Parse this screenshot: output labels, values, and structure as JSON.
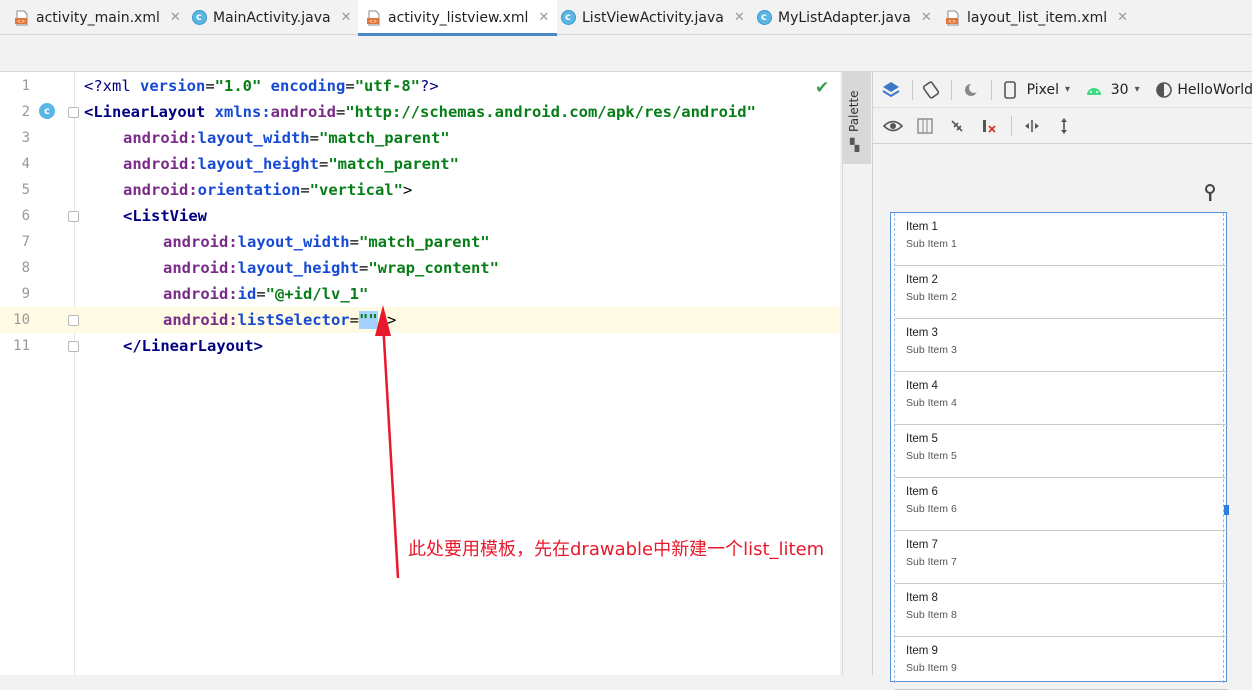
{
  "tabs": [
    {
      "label": "activity_main.xml",
      "icon": "xml-layout-icon",
      "active": false
    },
    {
      "label": "MainActivity.java",
      "icon": "class-c-icon",
      "active": false
    },
    {
      "label": "activity_listview.xml",
      "icon": "xml-layout-icon",
      "active": true
    },
    {
      "label": "ListViewActivity.java",
      "icon": "class-c-icon",
      "active": false
    },
    {
      "label": "MyListAdapter.java",
      "icon": "class-c-icon",
      "active": false
    },
    {
      "label": "layout_list_item.xml",
      "icon": "xml-layout-icon",
      "active": false
    }
  ],
  "close_glyph": "✕",
  "editor": {
    "current_line": 10,
    "lines": [
      {
        "n": "1"
      },
      {
        "n": "2"
      },
      {
        "n": "3"
      },
      {
        "n": "4"
      },
      {
        "n": "5"
      },
      {
        "n": "6"
      },
      {
        "n": "7"
      },
      {
        "n": "8"
      },
      {
        "n": "9"
      },
      {
        "n": "10"
      },
      {
        "n": "11"
      }
    ],
    "tokens": {
      "l1_a": "<?xml ",
      "l1_b": "version",
      "l1_c": "=",
      "l1_d": "\"1.0\"",
      "l1_e": " encoding",
      "l1_f": "=",
      "l1_g": "\"utf-8\"",
      "l1_h": "?>",
      "l2_a": "<LinearLayout ",
      "l2_b": "xmlns:",
      "l2_c": "android",
      "l2_d": "=",
      "l2_e": "\"http://schemas.android.com/apk/res/android\"",
      "l3_a": "android:",
      "l3_b": "layout_width",
      "l3_c": "=",
      "l3_d": "\"match_parent\"",
      "l4_a": "android:",
      "l4_b": "layout_height",
      "l4_c": "=",
      "l4_d": "\"match_parent\"",
      "l5_a": "android:",
      "l5_b": "orientation",
      "l5_c": "=",
      "l5_d": "\"vertical\"",
      "l5_e": ">",
      "l6_a": "<ListView",
      "l7_a": "android:",
      "l7_b": "layout_width",
      "l7_c": "=",
      "l7_d": "\"match_parent\"",
      "l8_a": "android:",
      "l8_b": "layout_height",
      "l8_c": "=",
      "l8_d": "\"wrap_content\"",
      "l9_a": "android:",
      "l9_b": "id",
      "l9_c": "=",
      "l9_d": "\"@+id/lv_1\"",
      "l10_a": "android:",
      "l10_b": "listSelector",
      "l10_c": "=",
      "l10_d": "\"\"",
      "l10_e": "/>",
      "l11_a": "</LinearLayout>"
    }
  },
  "palette": {
    "label": "Palette"
  },
  "design_toolbar": {
    "device": "Pixel",
    "api": "30",
    "theme": "HelloWorld"
  },
  "preview": {
    "items": [
      {
        "title": "Item 1",
        "sub": "Sub Item 1"
      },
      {
        "title": "Item 2",
        "sub": "Sub Item 2"
      },
      {
        "title": "Item 3",
        "sub": "Sub Item 3"
      },
      {
        "title": "Item 4",
        "sub": "Sub Item 4"
      },
      {
        "title": "Item 5",
        "sub": "Sub Item 5"
      },
      {
        "title": "Item 6",
        "sub": "Sub Item 6"
      },
      {
        "title": "Item 7",
        "sub": "Sub Item 7"
      },
      {
        "title": "Item 8",
        "sub": "Sub Item 8"
      },
      {
        "title": "Item 9",
        "sub": "Sub Item 9"
      }
    ]
  },
  "annotation": {
    "text": "此处要用模板，先在drawable中新建一个list_litem",
    "color": "#e8192c"
  }
}
